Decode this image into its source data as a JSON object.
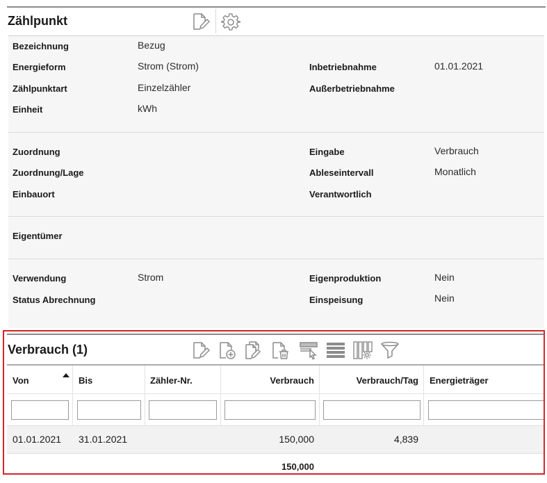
{
  "zaehlpunkt": {
    "title": "Zählpunkt",
    "toolbar_icons": [
      "edit-document-icon",
      "gear-icon"
    ],
    "fields": {
      "bezeichnung_label": "Bezeichnung",
      "bezeichnung_value": "Bezug",
      "energieform_label": "Energieform",
      "energieform_value": "Strom (Strom)",
      "zaehlpunktart_label": "Zählpunktart",
      "zaehlpunktart_value": "Einzelzähler",
      "einheit_label": "Einheit",
      "einheit_value": "kWh",
      "inbetriebnahme_label": "Inbetriebnahme",
      "inbetriebnahme_value": "01.01.2021",
      "ausserbetriebnahme_label": "Außerbetriebnahme",
      "zuordnung_label": "Zuordnung",
      "zuordnung_lage_label": "Zuordnung/Lage",
      "einbauort_label": "Einbauort",
      "eingabe_label": "Eingabe",
      "eingabe_value": "Verbrauch",
      "ableseintervall_label": "Ableseintervall",
      "ableseintervall_value": "Monatlich",
      "verantwortlich_label": "Verantwortlich",
      "eigentuemer_label": "Eigentümer",
      "verwendung_label": "Verwendung",
      "verwendung_value": "Strom",
      "status_abrechnung_label": "Status Abrechnung",
      "eigenproduktion_label": "Eigenproduktion",
      "eigenproduktion_value": "Nein",
      "einspeisung_label": "Einspeisung",
      "einspeisung_value": "Nein"
    }
  },
  "verbrauch": {
    "title": "Verbrauch (1)",
    "toolbar_icons": [
      "edit-document-icon",
      "add-document-icon",
      "copy-document-icon",
      "delete-document-icon",
      "select-columns-icon",
      "rows-icon",
      "column-settings-icon",
      "filter-icon"
    ],
    "columns": {
      "von": "Von",
      "bis": "Bis",
      "zaehler_nr": "Zähler-Nr.",
      "verbrauch": "Verbrauch",
      "verbrauch_tag": "Verbrauch/Tag",
      "energietraeger": "Energieträger"
    },
    "sorted_column": "Von",
    "sort_direction": "ascending",
    "filters": {
      "von": "",
      "bis": "",
      "zaehler_nr": "",
      "verbrauch": "",
      "verbrauch_tag": "",
      "energietraeger": ""
    },
    "rows": [
      {
        "von": "01.01.2021",
        "bis": "31.01.2021",
        "zaehler_nr": "",
        "verbrauch": "150,000",
        "verbrauch_tag": "4,839",
        "energietraeger": ""
      }
    ],
    "total_verbrauch": "150,000"
  },
  "colors": {
    "highlight_border": "#d6232b",
    "panel_background": "#f6f6f6",
    "row_background": "#f2f2f2",
    "icon_gray": "#8c8c8c"
  }
}
